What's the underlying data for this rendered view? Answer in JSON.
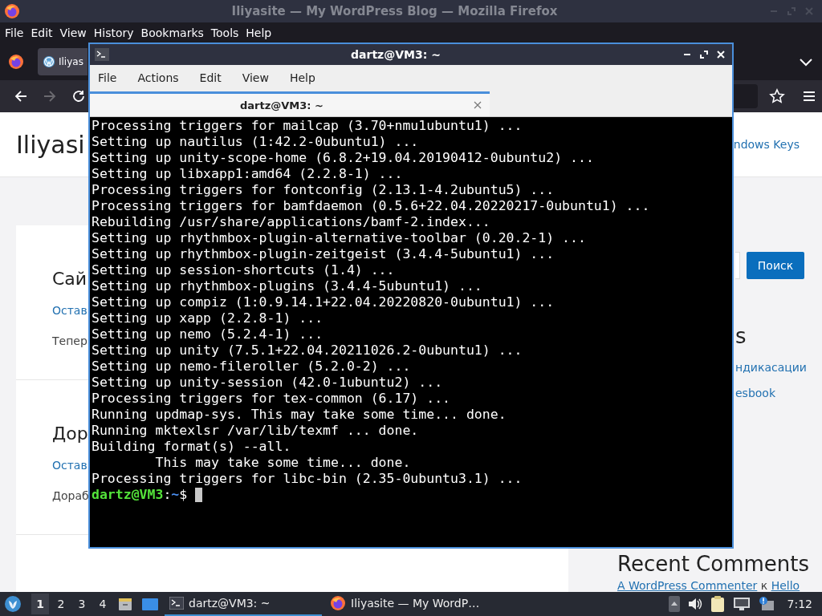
{
  "browser": {
    "title": "Iliyasite — My WordPress Blog — Mozilla Firefox",
    "menu": [
      "File",
      "Edit",
      "View",
      "History",
      "Bookmarks",
      "Tools",
      "Help"
    ],
    "tabs": [
      {
        "label": "Iliyas",
        "selected": true
      }
    ],
    "nav": [
      {
        "kind": "back",
        "disabled": false
      },
      {
        "kind": "forward",
        "disabled": true
      },
      {
        "kind": "reload",
        "disabled": false
      }
    ]
  },
  "page": {
    "site_title": "Iliyasi",
    "header_link": "ndows Keys",
    "posts": [
      {
        "title": "Сай",
        "link": "Остав",
        "excerpt": "Тепер"
      },
      {
        "title": "Дор",
        "link": "Остав",
        "excerpt": "Дораб"
      }
    ],
    "sidebar": {
      "search_button": "Поиск",
      "heading": "s",
      "links": [
        "ндикасации",
        "esbook"
      ],
      "comments_heading": "Recent Comments",
      "comment": {
        "author": "A WordPress Commenter",
        "joiner": "к",
        "post": "Hello"
      }
    }
  },
  "terminal": {
    "title": "dartz@VM3: ~",
    "menu": [
      "File",
      "Actions",
      "Edit",
      "View",
      "Help"
    ],
    "tabs": [
      {
        "label": "dartz@VM3: ~",
        "selected": true
      }
    ],
    "lines": [
      "Processing triggers for mailcap (3.70+nmu1ubuntu1) ...",
      "Setting up nautilus (1:42.2-0ubuntu1) ...",
      "Setting up unity-scope-home (6.8.2+19.04.20190412-0ubuntu2) ...",
      "Setting up libxapp1:amd64 (2.2.8-1) ...",
      "Processing triggers for fontconfig (2.13.1-4.2ubuntu5) ...",
      "Processing triggers for bamfdaemon (0.5.6+22.04.20220217-0ubuntu1) ...",
      "Rebuilding /usr/share/applications/bamf-2.index...",
      "Setting up rhythmbox-plugin-alternative-toolbar (0.20.2-1) ...",
      "Setting up rhythmbox-plugin-zeitgeist (3.4.4-5ubuntu1) ...",
      "Setting up session-shortcuts (1.4) ...",
      "Setting up rhythmbox-plugins (3.4.4-5ubuntu1) ...",
      "Setting up compiz (1:0.9.14.1+22.04.20220820-0ubuntu1) ...",
      "Setting up xapp (2.2.8-1) ...",
      "Setting up nemo (5.2.4-1) ...",
      "Setting up unity (7.5.1+22.04.20211026.2-0ubuntu1) ...",
      "Setting up nemo-fileroller (5.2.0-2) ...",
      "Setting up unity-session (42.0-1ubuntu2) ...",
      "Processing triggers for tex-common (6.17) ...",
      "Running updmap-sys. This may take some time... done.",
      "Running mktexlsr /var/lib/texmf ... done.",
      "Building format(s) --all.",
      "        This may take some time... done.",
      "Processing triggers for libc-bin (2.35-0ubuntu3.1) ..."
    ],
    "prompt": {
      "user": "dartz@VM3",
      "sep": ":",
      "path": "~",
      "symbol": "$"
    }
  },
  "taskbar": {
    "workspaces": [
      {
        "label": "1",
        "selected": true
      },
      {
        "label": "2",
        "selected": false
      },
      {
        "label": "3",
        "selected": false
      },
      {
        "label": "4",
        "selected": false
      }
    ],
    "tasks": [
      {
        "kind": "terminal",
        "label": "dartz@VM3: ~",
        "selected": true
      },
      {
        "kind": "firefox",
        "label": "Iliyasite — My WordP…",
        "selected": false
      }
    ],
    "clock": "7:12"
  }
}
